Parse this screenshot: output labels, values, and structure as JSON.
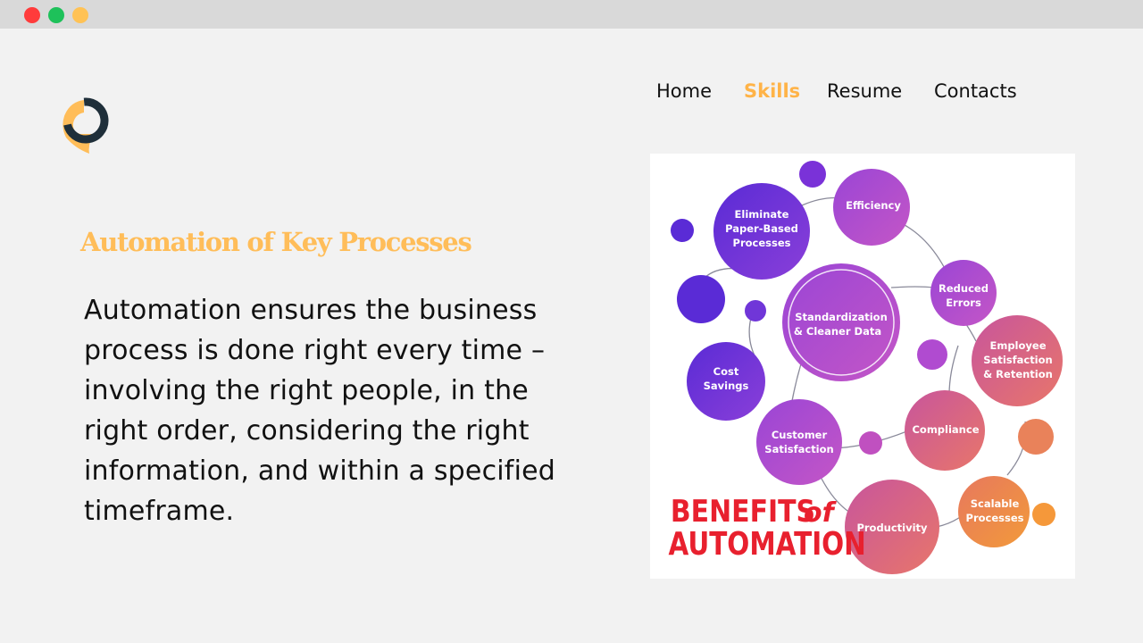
{
  "window": {
    "controls": [
      "close",
      "maximize",
      "minimize"
    ]
  },
  "logo": {
    "icon": "chat-bubble-logo-icon",
    "colors": {
      "ring": "#1f2f3a",
      "fill": "#ffbd59"
    }
  },
  "nav": {
    "items": [
      {
        "label": "Home",
        "active": false
      },
      {
        "label": "Skills",
        "active": true
      },
      {
        "label": "Resume",
        "active": false
      },
      {
        "label": "Contacts",
        "active": false
      }
    ],
    "active_color": "#ffb347"
  },
  "main": {
    "heading": "Automation of Key Processes",
    "body_lines": [
      "Automation ensures the business",
      "process is done right every time –",
      "involving the right people, in the",
      "right order, considering the right",
      "information, and within a specified",
      "timeframe."
    ]
  },
  "figure": {
    "title_line1": "BENEFITS",
    "title_of": "of",
    "title_line2": "AUTOMATION",
    "title_color": "#e8202e",
    "bubbles": [
      {
        "lines": [
          "Eliminate",
          "Paper-Based",
          "Processes"
        ]
      },
      {
        "lines": [
          "Efficiency"
        ]
      },
      {
        "lines": [
          "Reduced",
          "Errors"
        ]
      },
      {
        "lines": [
          "Standardization",
          "& Cleaner Data"
        ]
      },
      {
        "lines": [
          "Employee",
          "Satisfaction",
          "& Retention"
        ]
      },
      {
        "lines": [
          "Cost",
          "Savings"
        ]
      },
      {
        "lines": [
          "Customer",
          "Satisfaction"
        ]
      },
      {
        "lines": [
          "Compliance"
        ]
      },
      {
        "lines": [
          "Scalable",
          "Processes"
        ]
      },
      {
        "lines": [
          "Productivity"
        ]
      }
    ],
    "colors": {
      "purple": "#6a2bd0",
      "magenta": "#c455c9",
      "orange": "#f29a3a"
    }
  }
}
